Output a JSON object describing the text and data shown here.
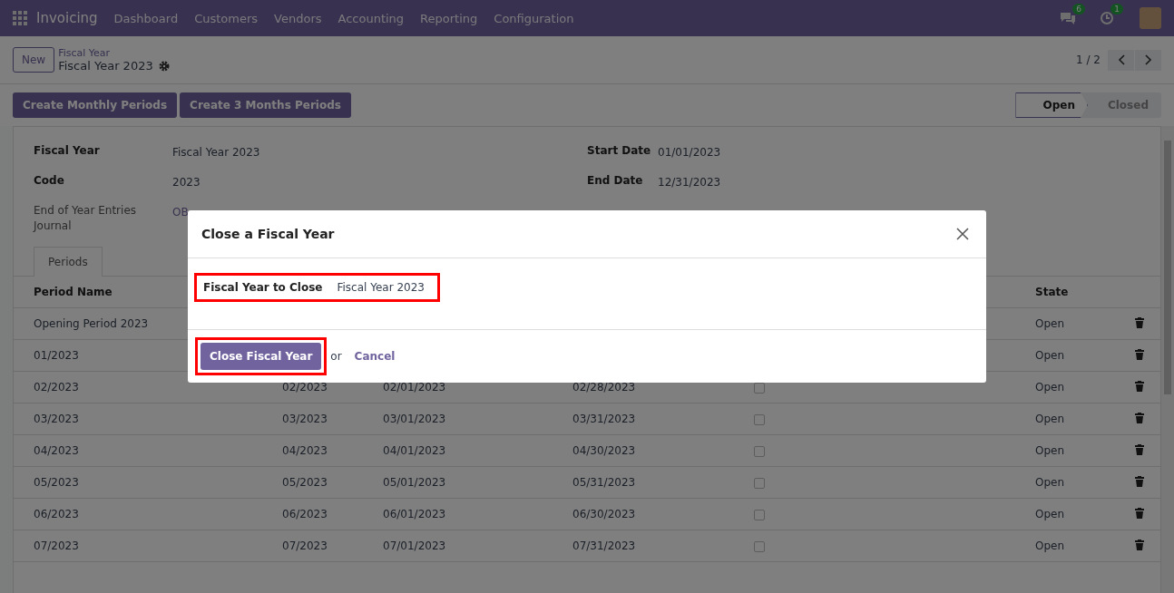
{
  "navbar": {
    "app": "Invoicing",
    "menus": [
      "Dashboard",
      "Customers",
      "Vendors",
      "Accounting",
      "Reporting",
      "Configuration"
    ],
    "messages_badge": "6",
    "activities_badge": "1"
  },
  "control_panel": {
    "new_button": "New",
    "breadcrumb_parent": "Fiscal Year",
    "breadcrumb_current": "Fiscal Year 2023",
    "pager": "1 / 2"
  },
  "actions": [
    "Create Monthly Periods",
    "Create 3 Months Periods"
  ],
  "status_bar": [
    {
      "label": "Open",
      "selected": true
    },
    {
      "label": "Closed",
      "selected": false
    }
  ],
  "form": {
    "left": [
      {
        "label": "Fiscal Year",
        "value": "Fiscal Year 2023"
      },
      {
        "label": "Code",
        "value": "2023"
      },
      {
        "label": "End of Year Entries Journal",
        "value": "OB",
        "kind": "link"
      }
    ],
    "right": [
      {
        "label": "Start Date",
        "value": "01/01/2023"
      },
      {
        "label": "End Date",
        "value": "12/31/2023"
      }
    ]
  },
  "tabs": [
    {
      "label": "Periods",
      "selected": true
    }
  ],
  "table": {
    "columns": [
      "Period Name",
      "",
      "",
      "",
      "",
      "State"
    ],
    "rows": [
      {
        "name": "Opening Period 2023",
        "state": "Open"
      },
      {
        "name": "01/2023",
        "state": "Open"
      },
      {
        "name": "02/2023",
        "code": "02/2023",
        "start": "02/01/2023",
        "end": "02/28/2023",
        "checked": false,
        "state": "Open"
      },
      {
        "name": "03/2023",
        "code": "03/2023",
        "start": "03/01/2023",
        "end": "03/31/2023",
        "checked": false,
        "state": "Open"
      },
      {
        "name": "04/2023",
        "code": "04/2023",
        "start": "04/01/2023",
        "end": "04/30/2023",
        "checked": false,
        "state": "Open"
      },
      {
        "name": "05/2023",
        "code": "05/2023",
        "start": "05/01/2023",
        "end": "05/31/2023",
        "checked": false,
        "state": "Open"
      },
      {
        "name": "06/2023",
        "code": "06/2023",
        "start": "06/01/2023",
        "end": "06/30/2023",
        "checked": false,
        "state": "Open"
      },
      {
        "name": "07/2023",
        "code": "07/2023",
        "start": "07/01/2023",
        "end": "07/31/2023",
        "checked": false,
        "state": "Open"
      }
    ]
  },
  "dialog": {
    "title": "Close a Fiscal Year",
    "field_label": "Fiscal Year to Close",
    "field_value": "Fiscal Year 2023",
    "field_highlighted": true,
    "confirm": "Close Fiscal Year",
    "confirm_highlighted": true,
    "or": "or",
    "cancel": "Cancel"
  }
}
